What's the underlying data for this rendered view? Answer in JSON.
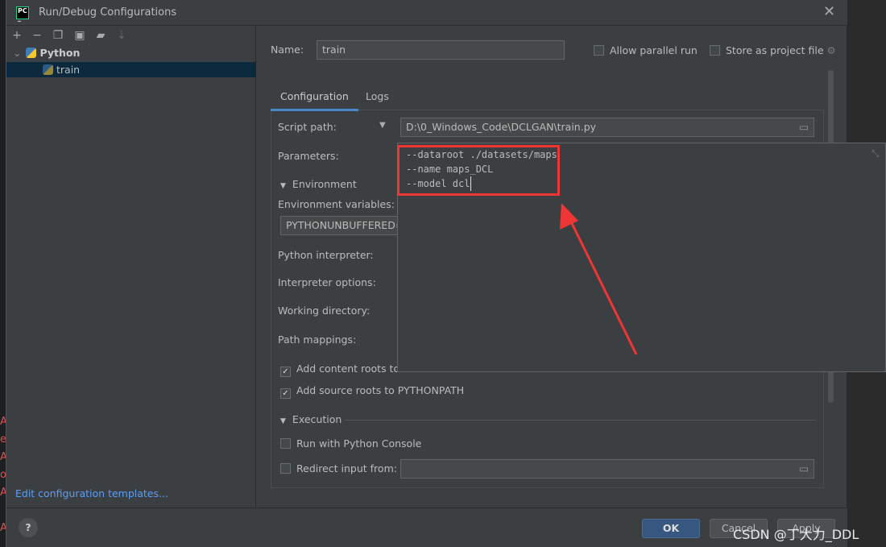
{
  "window": {
    "title": "Run/Debug Configurations",
    "logo": "PC"
  },
  "toolbar": {
    "icons": [
      "plus-icon",
      "minus-icon",
      "copy-icon",
      "save-icon",
      "folder-add-icon",
      "sort-icon"
    ]
  },
  "tree": {
    "group": "Python",
    "item": "train"
  },
  "sidebar_link": "Edit configuration templates...",
  "form": {
    "name_label": "Name:",
    "name_value": "train",
    "allow_parallel": "Allow parallel run",
    "store_project": "Store as project file",
    "tabs": [
      "Configuration",
      "Logs"
    ],
    "script_path_label": "Script path:",
    "script_path_value": "D:\\0_Windows_Code\\DCLGAN\\train.py",
    "parameters_label": "Parameters:",
    "environment_section": "Environment",
    "env_vars_label": "Environment variables:",
    "env_vars_value": "PYTHONUNBUFFERED=",
    "interpreter_label": "Python interpreter:",
    "interp_options_label": "Interpreter options:",
    "working_dir_label": "Working directory:",
    "path_mappings_label": "Path mappings:",
    "add_content_roots": "Add content roots to",
    "add_source_roots": "Add source roots to PYTHONPATH",
    "execution_section": "Execution",
    "run_console": "Run with Python Console",
    "redirect_input": "Redirect input from:"
  },
  "parameters_popup": {
    "lines": [
      "--dataroot ./datasets/maps",
      "--name maps_DCL",
      "--model dcl"
    ]
  },
  "buttons": {
    "ok": "OK",
    "cancel": "Cancel",
    "apply": "Apply",
    "help": "?"
  },
  "watermark": "CSDN @丁大力_DDL",
  "colors": {
    "accent": "#365880",
    "link": "#589df6",
    "highlight": "#f03535",
    "selection": "#0d293e"
  }
}
